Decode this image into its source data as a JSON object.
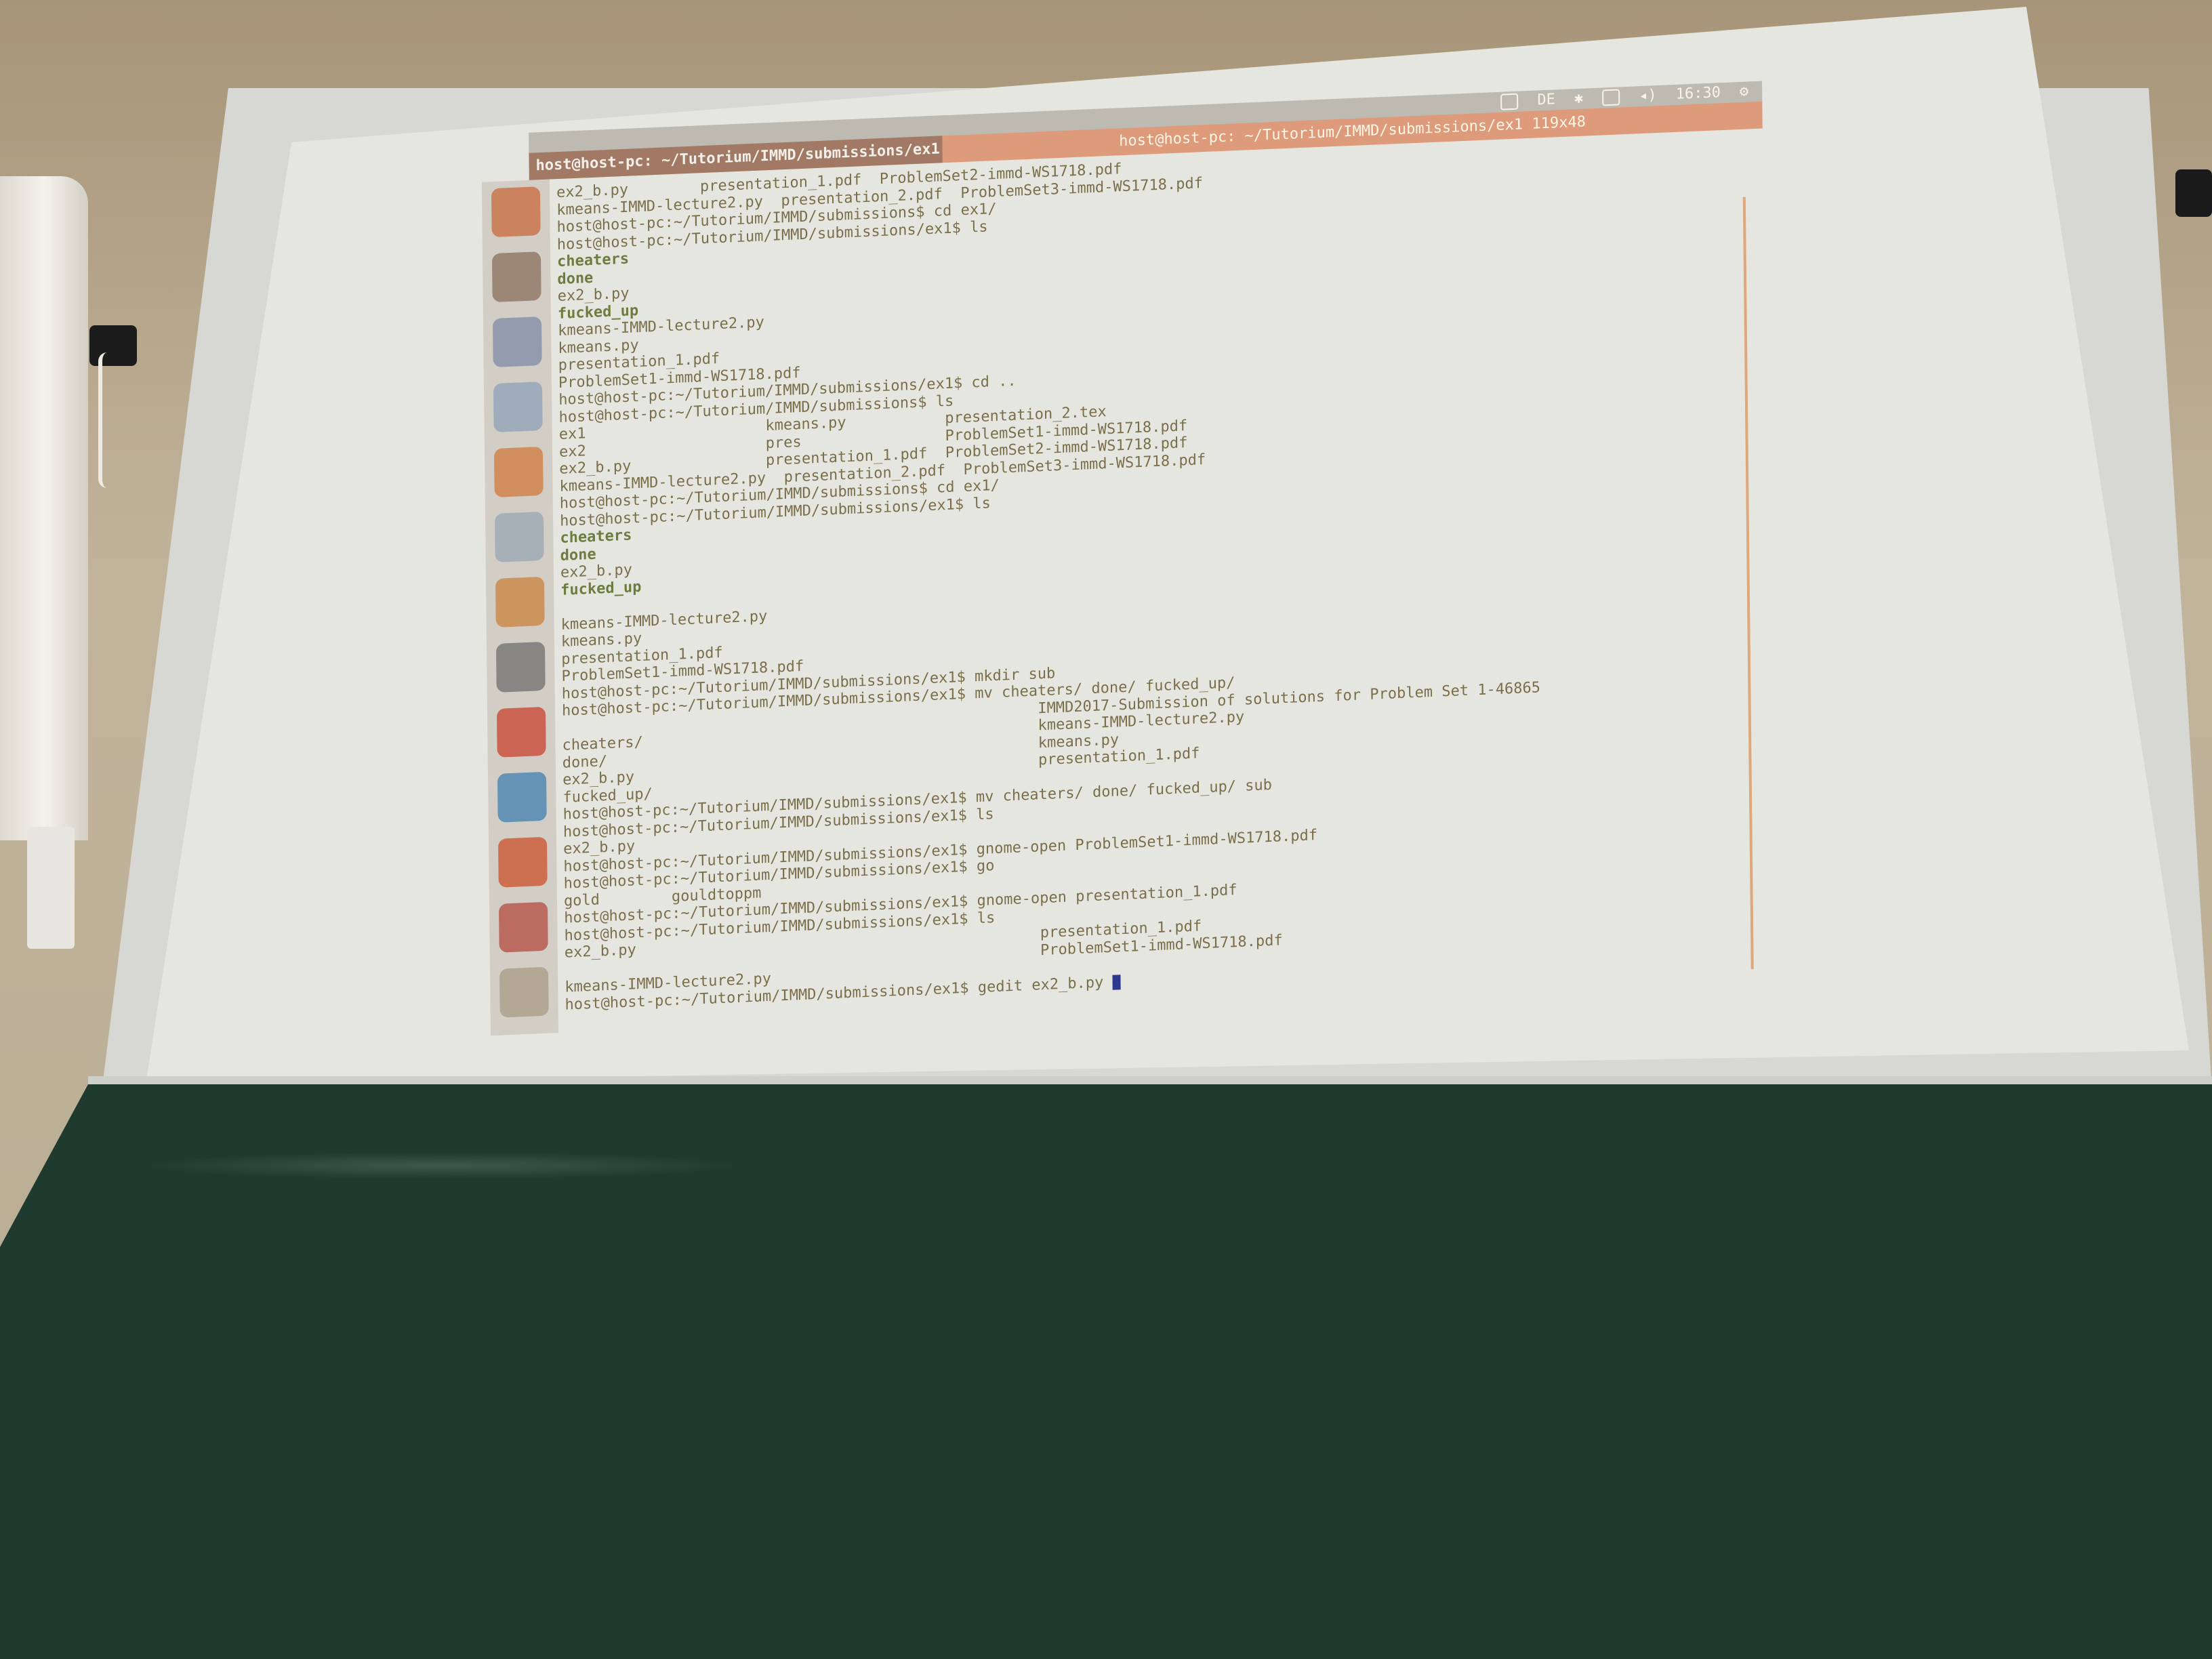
{
  "scene": {
    "description_free": true
  },
  "topbar": {
    "clock": "16:30",
    "keyboard": "DE"
  },
  "terminal": {
    "tab_title": "host@host-pc: ~/Tutorium/IMMD/submissions/ex1",
    "window_title": "host@host-pc: ~/Tutorium/IMMD/submissions/ex1 119x48",
    "lines": [
      {
        "text": "ex2_b.py        presentation_1.pdf  ProblemSet2-immd-WS1718.pdf",
        "type": "normal"
      },
      {
        "text": "kmeans-IMMD-lecture2.py  presentation_2.pdf  ProblemSet3-immd-WS1718.pdf",
        "type": "normal"
      },
      {
        "text": "host@host-pc:~/Tutorium/IMMD/submissions$ cd ex1/",
        "type": "normal"
      },
      {
        "text": "host@host-pc:~/Tutorium/IMMD/submissions/ex1$ ls",
        "type": "normal"
      },
      {
        "text": "cheaters",
        "type": "dir"
      },
      {
        "text": "done",
        "type": "dir"
      },
      {
        "text": "ex2_b.py",
        "type": "normal"
      },
      {
        "text": "fucked_up",
        "type": "dir"
      },
      {
        "text": "kmeans-IMMD-lecture2.py",
        "type": "normal"
      },
      {
        "text": "kmeans.py",
        "type": "normal"
      },
      {
        "text": "presentation_1.pdf",
        "type": "normal"
      },
      {
        "text": "ProblemSet1-immd-WS1718.pdf",
        "type": "normal"
      },
      {
        "text": "host@host-pc:~/Tutorium/IMMD/submissions/ex1$ cd ..",
        "type": "normal"
      },
      {
        "text": "host@host-pc:~/Tutorium/IMMD/submissions$ ls",
        "type": "normal"
      },
      {
        "text": "ex1                    kmeans.py           presentation_2.tex",
        "type": "normal"
      },
      {
        "text": "ex2                    pres                ProblemSet1-immd-WS1718.pdf",
        "type": "normal"
      },
      {
        "text": "ex2_b.py               presentation_1.pdf  ProblemSet2-immd-WS1718.pdf",
        "type": "normal"
      },
      {
        "text": "kmeans-IMMD-lecture2.py  presentation_2.pdf  ProblemSet3-immd-WS1718.pdf",
        "type": "normal"
      },
      {
        "text": "host@host-pc:~/Tutorium/IMMD/submissions$ cd ex1/",
        "type": "normal"
      },
      {
        "text": "host@host-pc:~/Tutorium/IMMD/submissions/ex1$ ls",
        "type": "normal"
      },
      {
        "text": "cheaters",
        "type": "dir"
      },
      {
        "text": "done",
        "type": "dir"
      },
      {
        "text": "ex2_b.py",
        "type": "normal"
      },
      {
        "text": "fucked_up",
        "type": "dir"
      },
      {
        "text": "",
        "type": "normal"
      },
      {
        "text": "kmeans-IMMD-lecture2.py",
        "type": "normal"
      },
      {
        "text": "kmeans.py",
        "type": "normal"
      },
      {
        "text": "presentation_1.pdf",
        "type": "normal"
      },
      {
        "text": "ProblemSet1-immd-WS1718.pdf",
        "type": "normal"
      },
      {
        "text": "host@host-pc:~/Tutorium/IMMD/submissions/ex1$ mkdir sub",
        "type": "normal"
      },
      {
        "text": "host@host-pc:~/Tutorium/IMMD/submissions/ex1$ mv cheaters/ done/ fucked_up/",
        "type": "normal"
      },
      {
        "text": "                                                     IMMD2017-Submission of solutions for Problem Set 1-46865",
        "type": "normal"
      },
      {
        "text": "cheaters/                                            kmeans-IMMD-lecture2.py",
        "type": "normal"
      },
      {
        "text": "done/                                                kmeans.py",
        "type": "normal"
      },
      {
        "text": "ex2_b.py                                             presentation_1.pdf",
        "type": "normal"
      },
      {
        "text": "fucked_up/",
        "type": "normal"
      },
      {
        "text": "host@host-pc:~/Tutorium/IMMD/submissions/ex1$ mv cheaters/ done/ fucked_up/ sub",
        "type": "normal"
      },
      {
        "text": "host@host-pc:~/Tutorium/IMMD/submissions/ex1$ ls",
        "type": "normal"
      },
      {
        "text": "ex2_b.py",
        "type": "normal"
      },
      {
        "text": "host@host-pc:~/Tutorium/IMMD/submissions/ex1$ gnome-open ProblemSet1-immd-WS1718.pdf",
        "type": "normal"
      },
      {
        "text": "host@host-pc:~/Tutorium/IMMD/submissions/ex1$ go",
        "type": "normal"
      },
      {
        "text": "gold        gouldtoppm",
        "type": "normal"
      },
      {
        "text": "host@host-pc:~/Tutorium/IMMD/submissions/ex1$ gnome-open presentation_1.pdf",
        "type": "normal"
      },
      {
        "text": "host@host-pc:~/Tutorium/IMMD/submissions/ex1$ ls",
        "type": "normal"
      },
      {
        "text": "ex2_b.py                                             presentation_1.pdf",
        "type": "normal"
      },
      {
        "text": "                                                     ProblemSet1-immd-WS1718.pdf",
        "type": "normal"
      },
      {
        "text": "kmeans-IMMD-lecture2.py",
        "type": "normal"
      },
      {
        "text": "host@host-pc:~/Tutorium/IMMD/submissions/ex1$ gedit ex2_b.py ",
        "type": "prompt"
      }
    ]
  },
  "launcher_icons": [
    "ubuntu-dash-icon",
    "files-icon",
    "text-editor-icon",
    "document-icon",
    "firefox-icon",
    "writer-icon",
    "software-center-icon",
    "amazon-icon",
    "settings-icon",
    "system-monitor-icon",
    "terminal-icon",
    "eclipse-icon",
    "trash-icon"
  ],
  "colors": {
    "terminal_title_accent": "#d65c2a",
    "chalkboard": "#1f3a2e",
    "screen": "#e6e6e1"
  }
}
